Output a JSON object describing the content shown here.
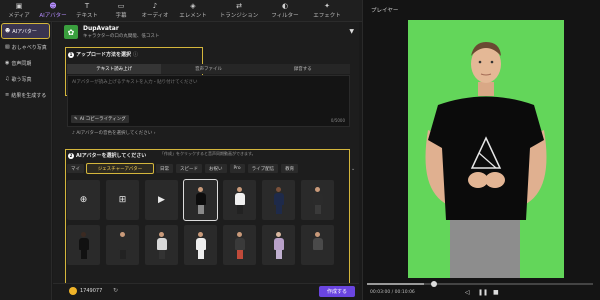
{
  "toolbar": {
    "items": [
      {
        "label": "メディア",
        "icon": "media-icon"
      },
      {
        "label": "AIアバター",
        "icon": "avatar-icon"
      },
      {
        "label": "テキスト",
        "icon": "text-icon"
      },
      {
        "label": "字幕",
        "icon": "subtitle-icon"
      },
      {
        "label": "オーディオ",
        "icon": "audio-icon"
      },
      {
        "label": "エレメント",
        "icon": "element-icon"
      },
      {
        "label": "トランジション",
        "icon": "transition-icon"
      },
      {
        "label": "フィルター",
        "icon": "filter-icon"
      },
      {
        "label": "エフェクト",
        "icon": "effect-icon"
      }
    ]
  },
  "sidebar": {
    "items": [
      {
        "label": "AIアバター"
      },
      {
        "label": "おしゃべり写真"
      },
      {
        "label": "音声同期"
      },
      {
        "label": "歌う写真"
      },
      {
        "label": "結果を生成する"
      }
    ]
  },
  "header": {
    "name": "DupAvatar",
    "subtitle": "キャラクターの口の丸間能、低コスト"
  },
  "step1": {
    "title": "アップロード方法を選択",
    "tabs": [
      "テキスト読み上げ",
      "音声ファイル",
      "録音する"
    ],
    "placeholder": "AIアバターが読み上げるテキストを入力・貼り付けてください",
    "copywriting_button": "AI コピーライティング",
    "counter": "0/5000",
    "voice_label": "AIアバターの音色を選択してください"
  },
  "step2": {
    "title": "AIアバターを選択してください",
    "hint": "「作成」をクリックすると音声同期動画ができます。",
    "categories": [
      "マイ",
      "ジェスチャーアバター",
      "日常",
      "スピード",
      "お祝い",
      "Pro",
      "ライブ配信",
      "教育"
    ]
  },
  "footer": {
    "credits": "1749077",
    "generate_button": "作成する"
  },
  "preview": {
    "title": "プレイヤー",
    "time": "00:03:00 / 00:10:06",
    "progress_fraction": 0.25
  },
  "colors": {
    "accent": "#6a45e0",
    "highlight": "#d4b63c",
    "green_screen": "#63d65a"
  }
}
